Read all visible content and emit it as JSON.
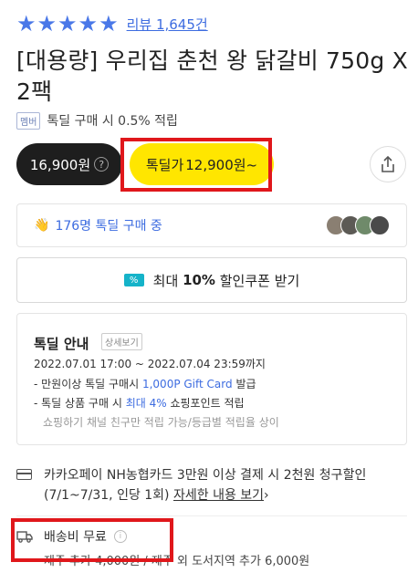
{
  "rating": {
    "stars": [
      "★",
      "★",
      "★",
      "★",
      "★"
    ],
    "review_link": "리뷰 1,645건"
  },
  "product": {
    "title": "[대용량] 우리집 춘천 왕 닭갈비 750g X 2팩"
  },
  "point": {
    "badge": "멤버",
    "text": "톡딜 구매 시 0.5% 적립"
  },
  "price": {
    "normal": "16,900원",
    "help_icon": "?",
    "deal_label": "톡딜가",
    "deal_price": "12,900원~"
  },
  "buying": {
    "icon": "👋",
    "text": "176명 톡딜 구매 중"
  },
  "coupon": {
    "icon": "%",
    "text_prefix": "최대",
    "text_bold": "10%",
    "text_suffix": "할인쿠폰 받기"
  },
  "deal_info": {
    "title": "톡딜 안내",
    "detail_button": "상세보기",
    "period": "2022.07.01 17:00 ~ 2022.07.04 23:59까지",
    "line1_prefix": "- 만원이상 톡딜 구매시",
    "line1_highlight": "1,000P Gift Card",
    "line1_suffix": "발급",
    "line2_prefix": "- 톡딜 상품 구매 시",
    "line2_highlight": "최대 4%",
    "line2_suffix": "쇼핑포인트 적립",
    "note": "쇼핑하기 채널 친구만 적립 가능/등급별 적립율 상이"
  },
  "card_promo": {
    "text": "카카오페이 NH농협카드 3만원 이상 결제 시 2천원 청구할인 (7/1~7/31, 인당 1회)",
    "link": "자세한 내용 보기",
    "chevron": "›"
  },
  "shipping": {
    "label": "배송비 무료",
    "info_icon": "i",
    "sub": "제주 추가 4,000원 / 제주 외 도서지역 추가 6,000원"
  },
  "colors": {
    "accent_blue": "#3d6ce0",
    "deal_yellow": "#ffe600",
    "highlight_red": "#e0171b"
  }
}
